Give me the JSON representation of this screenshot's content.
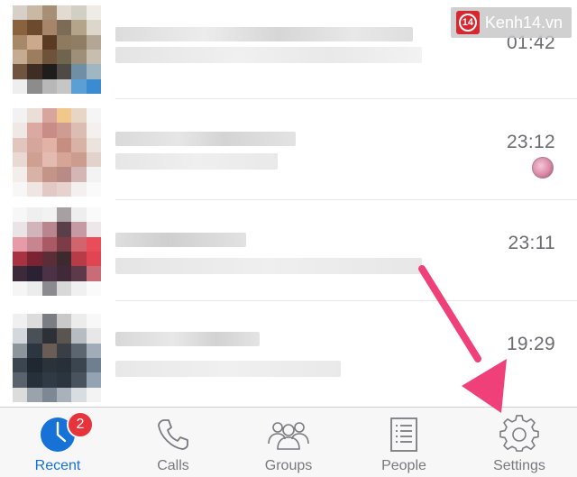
{
  "watermark": {
    "logo_number": "14",
    "text": "Kenh14.vn"
  },
  "conversations": [
    {
      "time": "01:42",
      "sticker": false
    },
    {
      "time": "23:12",
      "sticker": true
    },
    {
      "time": "23:11",
      "sticker": false
    },
    {
      "time": "19:29",
      "sticker": false
    }
  ],
  "tabbar": {
    "recent_label": "Recent",
    "recent_badge": "2",
    "calls_label": "Calls",
    "groups_label": "Groups",
    "people_label": "People",
    "settings_label": "Settings",
    "active_tab": "Recent",
    "icons": [
      "clock-icon",
      "phone-icon",
      "groups-icon",
      "people-list-icon",
      "gear-icon"
    ]
  },
  "colors": {
    "accent": "#1672d6",
    "badge": "#e7343c",
    "arrow": "#f0407a"
  }
}
